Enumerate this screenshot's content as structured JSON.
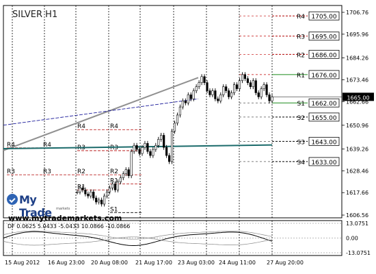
{
  "chart_data": {
    "type": "candlestick",
    "title": "SILVER H1",
    "watermark": "www.mytrademarkets.com",
    "brand": "My Trade",
    "brand_sub": "markets",
    "y_ticks": [
      1706.76,
      1695.96,
      1684.26,
      1673.46,
      1662.66,
      1650.96,
      1639.26,
      1628.46,
      1617.66,
      1606.56
    ],
    "y_range": [
      1606.56,
      1706.76
    ],
    "current_price": "1665.00",
    "x_ticks": [
      "15 Aug 2012",
      "16 Aug 23:00",
      "20 Aug 08:00",
      "21 Aug 17:00",
      "23 Aug 03:00",
      "24 Aug 11:00",
      "27 Aug 20:00"
    ],
    "levels": [
      {
        "label": "R4",
        "value": "1705.00"
      },
      {
        "label": "R3",
        "value": "1695.00"
      },
      {
        "label": "R2",
        "value": "1686.00"
      },
      {
        "label": "R1",
        "value": "1676.00"
      },
      {
        "label": "S1",
        "value": "1662.00"
      },
      {
        "label": "S2",
        "value": "1655.00"
      },
      {
        "label": "S3",
        "value": "1643.00"
      },
      {
        "label": "S4",
        "value": "1633.00"
      }
    ],
    "period_labels": [
      {
        "label": "R4",
        "value": 1639.8,
        "x0": 0,
        "x1": 53
      },
      {
        "label": "R3",
        "value": 1626.5,
        "x0": 0,
        "x1": 53
      },
      {
        "label": "R4",
        "value": 1639.8,
        "x0": 53,
        "x1": 103
      },
      {
        "label": "R3",
        "value": 1626.5,
        "x0": 53,
        "x1": 103
      },
      {
        "label": "R4",
        "value": 1648.8,
        "x0": 103,
        "x1": 151
      },
      {
        "label": "R3",
        "value": 1638.4,
        "x0": 103,
        "x1": 151
      },
      {
        "label": "R2",
        "value": 1626.5,
        "x0": 103,
        "x1": 151
      },
      {
        "label": "R1",
        "value": 1619.0,
        "x0": 103,
        "x1": 151
      },
      {
        "label": "R4",
        "value": 1648.8,
        "x0": 151,
        "x1": 199
      },
      {
        "label": "R3",
        "value": 1638.4,
        "x0": 151,
        "x1": 199
      },
      {
        "label": "R2",
        "value": 1626.5,
        "x0": 151,
        "x1": 199
      },
      {
        "label": "R1",
        "value": 1622.0,
        "x0": 151,
        "x1": 199
      },
      {
        "label": "S1",
        "value": 1607.8,
        "x0": 151,
        "x1": 199
      }
    ],
    "indicator": {
      "label": "DF 0.0625 5.0433 -5.0433 10.0866 -10.0866",
      "y_ticks": [
        "13.0751",
        "0.00",
        "-13.0751"
      ],
      "y_range": [
        -13.0751,
        13.0751
      ]
    }
  }
}
